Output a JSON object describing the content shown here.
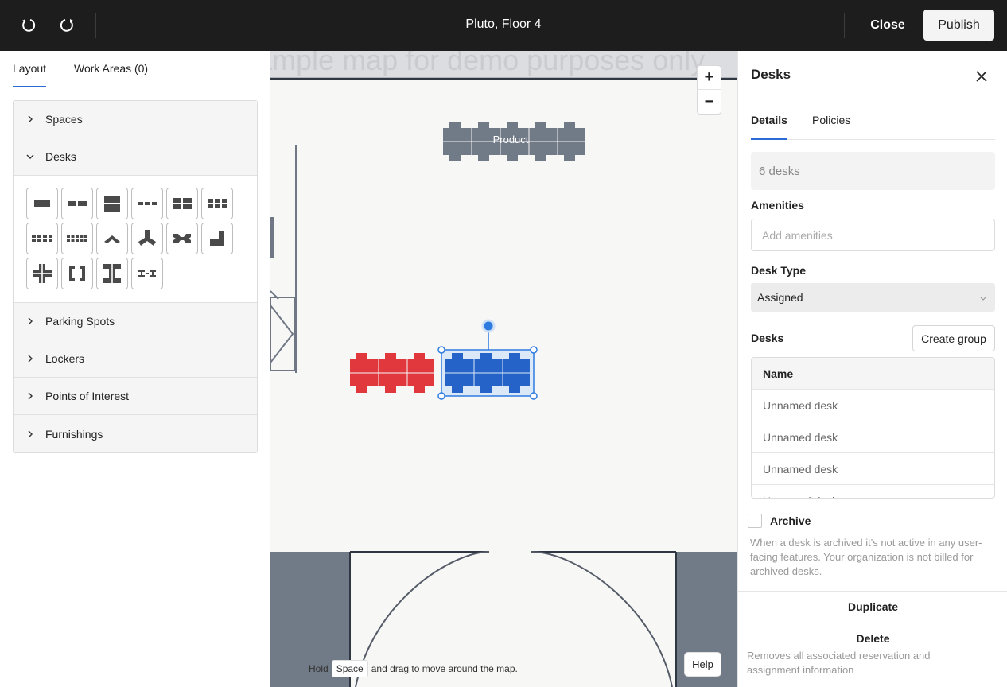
{
  "topbar": {
    "title": "Pluto, Floor 4",
    "undo_icon": "undo-icon",
    "redo_icon": "redo-icon",
    "close_label": "Close",
    "publish_label": "Publish"
  },
  "left_panel": {
    "tabs": [
      {
        "label": "Layout",
        "active": true
      },
      {
        "label": "Work Areas (0)",
        "active": false
      }
    ],
    "sections": [
      {
        "label": "Spaces",
        "expanded": false
      },
      {
        "label": "Desks",
        "expanded": true
      },
      {
        "label": "Parking Spots",
        "expanded": false
      },
      {
        "label": "Lockers",
        "expanded": false
      },
      {
        "label": "Points of Interest",
        "expanded": false
      },
      {
        "label": "Furnishings",
        "expanded": false
      }
    ],
    "desk_templates": [
      "single-desk-icon",
      "two-desk-row-icon",
      "two-desk-stack-icon",
      "three-desk-row-icon",
      "four-desk-cluster-icon",
      "six-desk-cluster-icon",
      "eight-desk-cluster-icon",
      "ten-desk-cluster-icon",
      "angled-desk-icon",
      "three-way-desk-icon",
      "bowtie-desk-icon",
      "l-shaped-desk-icon",
      "cross-desk-icon",
      "bracket-desk-icon",
      "i-beam-desk-icon",
      "double-i-desk-icon"
    ]
  },
  "map": {
    "watermark": "Sample map for demo purposes only",
    "product_label": "Product",
    "zoom_in_label": "+",
    "zoom_out_label": "−",
    "hint_prefix": "Hold",
    "hint_key": "Space",
    "hint_suffix": "and drag to move around the map.",
    "help_label": "Help",
    "colors": {
      "floor_bg": "#f7f7f6",
      "wall": "#6f7785",
      "desk_grey": "#717a87",
      "desk_red": "#e0383d",
      "desk_blue": "#2563c9",
      "selection": "#2e7be0"
    }
  },
  "right_panel": {
    "title": "Desks",
    "close_icon": "close-icon",
    "tabs": [
      {
        "label": "Details",
        "active": true
      },
      {
        "label": "Policies",
        "active": false
      }
    ],
    "desk_count": "6 desks",
    "amenities_label": "Amenities",
    "amenities_placeholder": "Add amenities",
    "desk_type_label": "Desk Type",
    "desk_type_value": "Assigned",
    "desks_label": "Desks",
    "create_group_label": "Create group",
    "table_header": "Name",
    "rows": [
      "Unnamed desk",
      "Unnamed desk",
      "Unnamed desk",
      "Unnamed desk"
    ],
    "archive_label": "Archive",
    "archive_help": "When a desk is archived it's not active in any user-facing features. Your organization is not billed for archived desks.",
    "duplicate_label": "Duplicate",
    "delete_label": "Delete",
    "delete_help": "Removes all associated reservation and assignment information"
  }
}
